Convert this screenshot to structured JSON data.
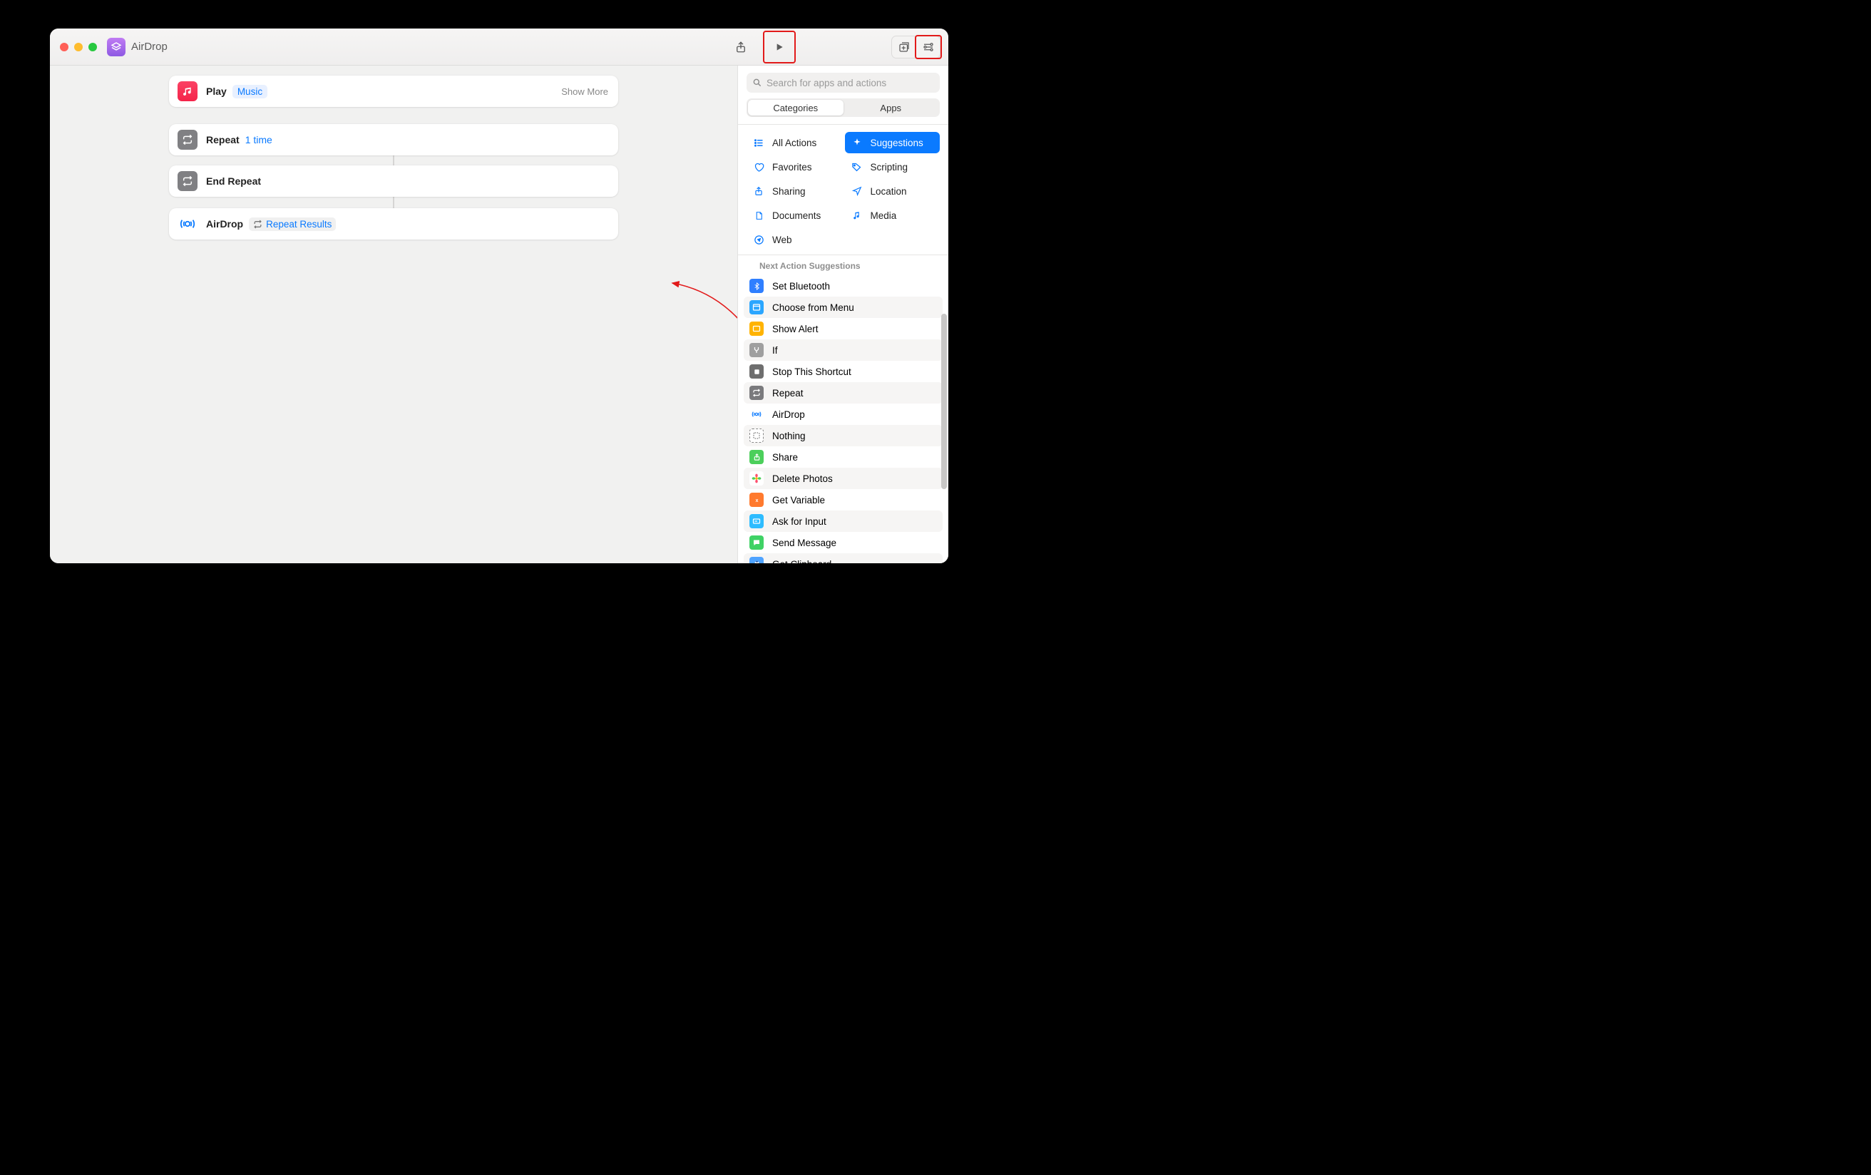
{
  "window": {
    "title": "AirDrop"
  },
  "actions": {
    "play": {
      "label": "Play",
      "token": "Music",
      "showMore": "Show More"
    },
    "repeat": {
      "label": "Repeat",
      "token": "1 time"
    },
    "endRepeat": {
      "label": "End Repeat"
    },
    "airdrop": {
      "label": "AirDrop",
      "token": "Repeat Results"
    }
  },
  "sidebar": {
    "search": {
      "placeholder": "Search for apps and actions"
    },
    "tabs": {
      "categories": "Categories",
      "apps": "Apps"
    },
    "categories": [
      {
        "label": "All Actions",
        "icon": "list-icon",
        "color": "#0a7aff"
      },
      {
        "label": "Suggestions",
        "icon": "sparkle-icon",
        "color": "#fff",
        "active": true
      },
      {
        "label": "Favorites",
        "icon": "heart-icon",
        "color": "#0a7aff"
      },
      {
        "label": "Scripting",
        "icon": "tag-icon",
        "color": "#0a7aff"
      },
      {
        "label": "Sharing",
        "icon": "share-icon",
        "color": "#0a7aff"
      },
      {
        "label": "Location",
        "icon": "nav-arrow-icon",
        "color": "#0a7aff"
      },
      {
        "label": "Documents",
        "icon": "doc-icon",
        "color": "#0a7aff"
      },
      {
        "label": "Media",
        "icon": "music-note-icon",
        "color": "#0a7aff"
      },
      {
        "label": "Web",
        "icon": "compass-icon",
        "color": "#0a7aff"
      }
    ],
    "suggestionsHeader": "Next Action Suggestions",
    "suggestions": [
      {
        "label": "Set Bluetooth",
        "bg": "#2f7fff",
        "glyph": "bluetooth"
      },
      {
        "label": "Choose from Menu",
        "bg": "#2ba6ff",
        "glyph": "menu"
      },
      {
        "label": "Show Alert",
        "bg": "#ffb300",
        "glyph": "alert"
      },
      {
        "label": "If",
        "bg": "#9f9f9f",
        "glyph": "branch"
      },
      {
        "label": "Stop This Shortcut",
        "bg": "#6e6e6e",
        "glyph": "stop"
      },
      {
        "label": "Repeat",
        "bg": "#7a7a7d",
        "glyph": "repeat"
      },
      {
        "label": "AirDrop",
        "bg": "#ffffff",
        "glyph": "airdrop",
        "ring": true
      },
      {
        "label": "Nothing",
        "bg": "#ffffff",
        "glyph": "nothing",
        "border": true
      },
      {
        "label": "Share",
        "bg": "#4ccf5b",
        "glyph": "share"
      },
      {
        "label": "Delete Photos",
        "bg": "#ffffff",
        "glyph": "photos"
      },
      {
        "label": "Get Variable",
        "bg": "#ff7a2e",
        "glyph": "var"
      },
      {
        "label": "Ask for Input",
        "bg": "#2ebcff",
        "glyph": "input"
      },
      {
        "label": "Send Message",
        "bg": "#3fd265",
        "glyph": "message"
      },
      {
        "label": "Get Clipboard",
        "bg": "#4fa3ff",
        "glyph": "clipboard"
      }
    ]
  }
}
